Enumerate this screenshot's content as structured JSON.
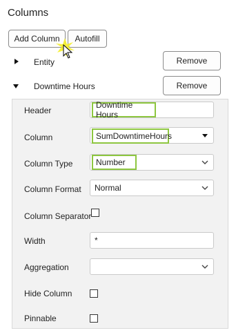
{
  "header": {
    "title": "Columns"
  },
  "toolbar": {
    "add_label": "Add Column",
    "autofill_label": "Autofill"
  },
  "rows": [
    {
      "label": "Entity",
      "remove_label": "Remove"
    },
    {
      "label": "Downtime Hours",
      "remove_label": "Remove"
    }
  ],
  "panel": {
    "header_label": "Header",
    "header_value": "Downtime Hours",
    "column_label": "Column",
    "column_value": "SumDowntimeHours",
    "column_type_label": "Column Type",
    "column_type_value": "Number",
    "column_format_label": "Column Format",
    "column_format_value": "Normal",
    "column_separator_label": "Column Separator",
    "width_label": "Width",
    "width_value": "*",
    "aggregation_label": "Aggregation",
    "aggregation_value": "",
    "hide_column_label": "Hide Column",
    "pinnable_label": "Pinnable"
  },
  "colors": {
    "highlight": "#8dc63f",
    "panel_bg": "#f2f2f2"
  },
  "icons": {
    "expand_collapsed": "triangle-right-icon",
    "expand_open": "triangle-down-icon",
    "select": "chevron-down-icon"
  }
}
